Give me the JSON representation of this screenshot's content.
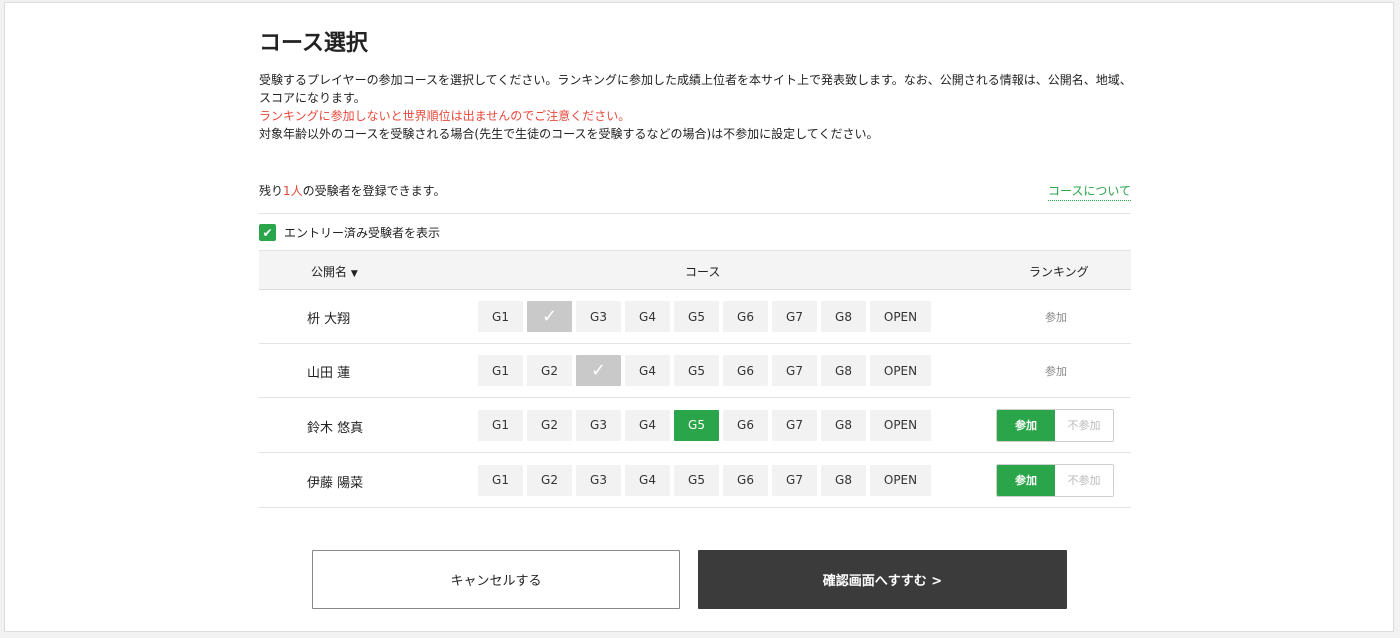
{
  "page": {
    "title": "コース選択",
    "desc_line1": "受験するプレイヤーの参加コースを選択してください。ランキングに参加した成績上位者を本サイト上で発表致します。なお、公開される情報は、公開名、地域、スコアになります。",
    "desc_warning": "ランキングに参加しないと世界順位は出ませんのでご注意ください。",
    "desc_line3": "対象年齢以外のコースを受験される場合(先生で生徒のコースを受験するなどの場合)は不参加に設定してください。"
  },
  "remain": {
    "prefix": "残り",
    "count": "1人",
    "suffix": "の受験者を登録できます。"
  },
  "about_link": "コースについて",
  "show_entered": {
    "checked": true,
    "label": "エントリー済み受験者を表示",
    "check_glyph": "✔"
  },
  "table": {
    "headers": {
      "name": "公開名",
      "sort_glyph": "▼",
      "course": "コース",
      "ranking": "ランキング"
    },
    "course_labels": [
      "G1",
      "G2",
      "G3",
      "G4",
      "G5",
      "G6",
      "G7",
      "G8",
      "OPEN"
    ],
    "rows": [
      {
        "name": "枡 大翔",
        "selected_course": "G2",
        "selected_style": "check",
        "ranking_mode": "text",
        "ranking_text": "参加"
      },
      {
        "name": "山田 蓮",
        "selected_course": "G3",
        "selected_style": "check",
        "ranking_mode": "text",
        "ranking_text": "参加"
      },
      {
        "name": "鈴木 悠真",
        "selected_course": "G5",
        "selected_style": "green",
        "ranking_mode": "toggle",
        "ranking_on": "参加",
        "ranking_off": "不参加"
      },
      {
        "name": "伊藤 陽菜",
        "selected_course": "",
        "selected_style": "none",
        "ranking_mode": "toggle",
        "ranking_on": "参加",
        "ranking_off": "不参加"
      }
    ]
  },
  "buttons": {
    "cancel": "キャンセルする",
    "next": "確認画面へすすむ >"
  },
  "colors": {
    "accent_green": "#2aa549",
    "warning_red": "#e8483b",
    "dark_button": "#3b3b3b"
  }
}
